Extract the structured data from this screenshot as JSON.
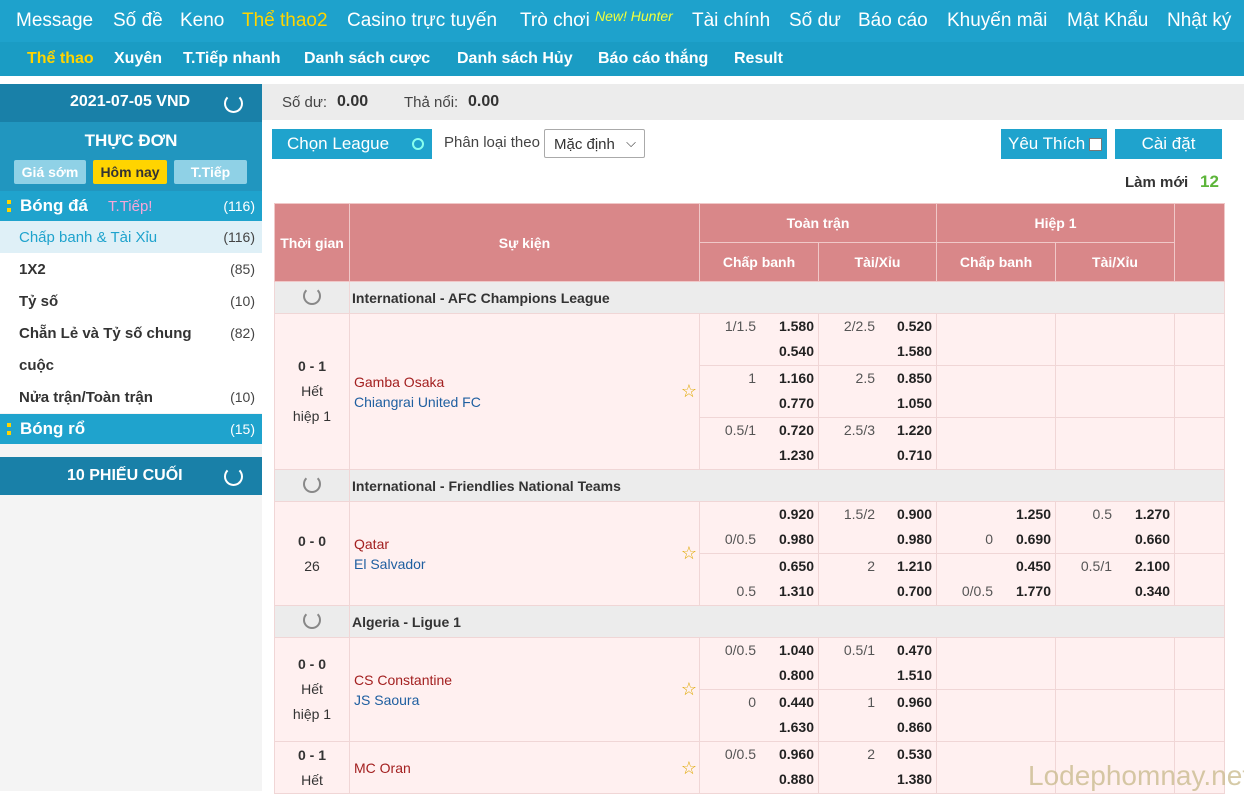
{
  "topnav": [
    "Message",
    "Số đề",
    "Keno",
    "Thể thao2",
    "Casino trực tuyến",
    "Trò chơi",
    "Tài chính",
    "Số dư",
    "Báo cáo",
    "Khuyến mãi",
    "Mật Khẩu",
    "Nhật ký"
  ],
  "topnav_badge": "New! Hunter",
  "subnav": [
    "Thể thao",
    "Xuyên",
    "T.Tiếp nhanh",
    "Danh sách cược",
    "Danh sách Hủy",
    "Báo cáo thắng",
    "Result"
  ],
  "left": {
    "date": "2021-07-05 VND",
    "menu_title": "THỰC ĐƠN",
    "buttons": [
      "Giá sớm",
      "Hôm nay",
      "T.Tiếp"
    ],
    "soccer": {
      "label": "Bóng đá",
      "live": "T.Tiếp!",
      "count": "(116)"
    },
    "items": [
      {
        "label": "Chấp banh & Tài Xỉu",
        "count": "(116)"
      },
      {
        "label": "1X2",
        "count": "(85)"
      },
      {
        "label": "Tỷ số",
        "count": "(10)"
      },
      {
        "label": "Chẵn Lẻ và Tỷ số chung",
        "label2": "cuộc",
        "count": "(82)"
      },
      {
        "label": "Nửa trận/Toàn trận",
        "count": "(10)"
      }
    ],
    "basketball": {
      "label": "Bóng rổ",
      "count": "(15)"
    },
    "last_bets": "10 PHIẾU CUỐI"
  },
  "main": {
    "balance_label": "Số dư:",
    "balance": "0.00",
    "float_label": "Thả nổi:",
    "float": "0.00",
    "league_btn": "Chọn League",
    "sort_label": "Phân loại theo",
    "sort_value": "Mặc định",
    "fav_btn": "Yêu Thích",
    "settings_btn": "Cài đặt",
    "refresh_label": "Làm mới",
    "refresh_count": "12"
  },
  "table": {
    "h_time": "Thời gian",
    "h_event": "Sự kiện",
    "h_full": "Toàn trận",
    "h_half": "Hiệp 1",
    "h_hdp": "Chấp banh",
    "h_ou": "Tài/Xỉu",
    "h_hdp2": "Chấp banh",
    "h_ou2": "Tài/Xỉu"
  },
  "leagues": [
    {
      "name": "International - AFC Champions League",
      "matches": [
        {
          "score": "0 - 1",
          "status": "Hết",
          "status2": "hiệp 1",
          "home": "Gamba Osaka",
          "away": "Chiangrai United FC",
          "rows": [
            {
              "hdp": "1/1.5",
              "h1": "1.580",
              "h2": "0.540",
              "ou": "2/2.5",
              "o1": "0.520",
              "o2": "1.580"
            },
            {
              "hdp": "1",
              "h1": "1.160",
              "h2": "0.770",
              "ou": "2.5",
              "o1": "0.850",
              "o2": "1.050"
            },
            {
              "hdp": "0.5/1",
              "h1": "0.720",
              "h2": "1.230",
              "ou": "2.5/3",
              "o1": "1.220",
              "o2": "0.710"
            }
          ]
        }
      ]
    },
    {
      "name": "International - Friendlies National Teams",
      "matches": [
        {
          "score": "0 - 0",
          "status": "26",
          "status2": "",
          "home": "Qatar",
          "away": "El Salvador",
          "rows": [
            {
              "hdp": "",
              "hdpB": "0/0.5",
              "h1": "0.920",
              "h2": "0.980",
              "ou": "1.5/2",
              "o1": "0.900",
              "o2": "0.980",
              "fhdp": "",
              "fhdpB": "0",
              "f1": "1.250",
              "f2": "0.690",
              "fou": "0.5",
              "fo1": "1.270",
              "fo2": "0.660"
            },
            {
              "hdp": "",
              "hdpB": "0.5",
              "h1": "0.650",
              "h2": "1.310",
              "ou": "2",
              "o1": "1.210",
              "o2": "0.700",
              "fhdp": "",
              "fhdpB": "0/0.5",
              "f1": "0.450",
              "f2": "1.770",
              "fou": "0.5/1",
              "fo1": "2.100",
              "fo2": "0.340"
            }
          ]
        }
      ]
    },
    {
      "name": "Algeria - Ligue 1",
      "matches": [
        {
          "score": "0 - 0",
          "status": "Hết",
          "status2": "hiệp 1",
          "home": "CS Constantine",
          "away": "JS Saoura",
          "rows": [
            {
              "hdp": "0/0.5",
              "h1": "1.040",
              "h2": "0.800",
              "ou": "0.5/1",
              "o1": "0.470",
              "o2": "1.510"
            },
            {
              "hdp": "0",
              "h1": "0.440",
              "h2": "1.630",
              "ou": "1",
              "o1": "0.960",
              "o2": "0.860"
            }
          ]
        },
        {
          "score": "0 - 1",
          "status": "Hết",
          "status2": "",
          "home": "MC Oran",
          "away": "",
          "rows": [
            {
              "hdp": "0/0.5",
              "h1": "0.960",
              "h2": "0.880",
              "ou": "2",
              "o1": "0.530",
              "o2": "1.380"
            }
          ]
        }
      ]
    }
  ],
  "watermark": "Lodephomnay.net",
  "colors": {
    "nav": "#1ea2cc",
    "active": "#ffd400",
    "header": "#d98789",
    "row": "#fff0f0"
  }
}
